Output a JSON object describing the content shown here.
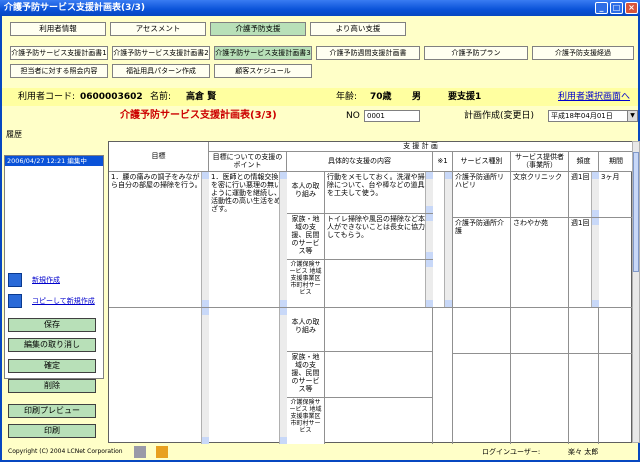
{
  "window": {
    "title": "介護予防サービス支援計画表(3/3)"
  },
  "main_tabs": [
    "利用者情報",
    "アセスメント",
    "介護予防支援",
    "より高い支援"
  ],
  "sub_tabs_row1": [
    "介護予防サービス支援計画書1",
    "介護予防サービス支援計画書2",
    "介護予防サービス支援計画書3",
    "介護予防週間支援計画書",
    "介護予防プラン",
    "介護予防支援経過"
  ],
  "sub_tabs_row2": [
    "担当者に対する照会内容",
    "福祉用具パターン作成",
    "顧客スケジュール"
  ],
  "info": {
    "code_label": "利用者コード:",
    "code_value": "0600003602",
    "name_label": "名前:",
    "name_value": "高倉 賢",
    "age_label": "年齢:",
    "age_value": "70歳",
    "sex": "男",
    "care_level": "要支援1",
    "user_select_link": "利用者選択画面へ"
  },
  "form": {
    "title": "介護予防サービス支援計画表(3/3)",
    "no_label": "NO",
    "no_value": "0001",
    "date_label": "計画作成(変更日)",
    "date_value": "平成18年04月01日"
  },
  "sidebar": {
    "history_label": "履歴",
    "history_items": [
      "2006/04/27 12:21 編集中"
    ],
    "new_link": "新規作成",
    "copy_link": "コピーして新規作成",
    "buttons": [
      "保存",
      "編集の取り消し",
      "確定",
      "削除",
      "印刷プレビュー",
      "印刷"
    ]
  },
  "grid": {
    "group_header": "支 援 計 画",
    "headers": {
      "goal": "目標",
      "point": "目標についての支援のポイント",
      "content": "具体的な支援の内容",
      "note": "※1",
      "service_type": "サービス種別",
      "provider": "サービス提供者（事業所）",
      "frequency": "頻度",
      "period": "期間"
    },
    "category_labels": [
      "本人の取り組み",
      "家族・地域の支援、民間のサービス等",
      "介護保険サービス 地域支援事業区市町村サービス"
    ],
    "rows": [
      {
        "goal": "1．腰の痛みの調子をみながら自分の部屋の掃除を行う。",
        "point": "1．医師との情報交換を密に行い悪理の無いように運動を継続し、活動性の高い生活をめざす。",
        "content_self": "行動をメモしておく。洗濯や掃除について、台や棒などの道具を工夫して使う。",
        "content_family": "トイレ掃除や風呂の掃除など本人ができないことは長女に協力してもらう。",
        "services": [
          {
            "type": "介護予防通所リハビリ",
            "provider": "文京クリニック",
            "frequency": "週1回",
            "period": "3ヶ月"
          },
          {
            "type": "介護予防通所介護",
            "provider": "さわやか苑",
            "frequency": "週1回",
            "period": ""
          }
        ]
      }
    ]
  },
  "footer": {
    "copyright": "Copyright (C) 2004 LCNet Corporation",
    "login_label": "ログインユーザー:",
    "login_user": "楽々 太郎"
  },
  "colors": {
    "app_bg": "#ffffc8",
    "title_bar": "#0a52d8",
    "active_tab": "#b8e0b8",
    "heading_red": "#cc0000",
    "link": "#0000cc"
  }
}
